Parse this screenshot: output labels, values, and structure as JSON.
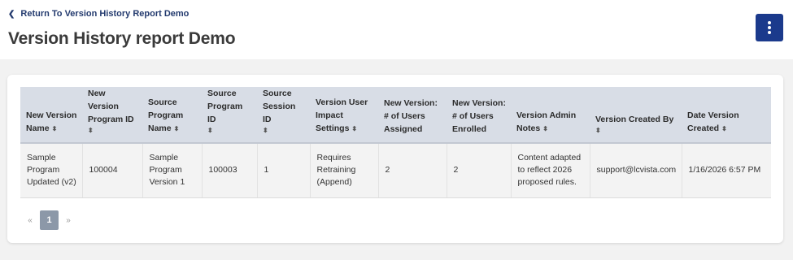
{
  "header": {
    "back_link": "Return To Version History Report Demo",
    "title": "Version History report Demo"
  },
  "table": {
    "columns": [
      {
        "label": "New Version Name",
        "sort": "⬍"
      },
      {
        "label": "New Version Program ID",
        "sort": "⬍"
      },
      {
        "label": "Source Program Name",
        "sort": "⬍"
      },
      {
        "label": "Source Program ID",
        "sort": "⬍"
      },
      {
        "label": "Source Session ID",
        "sort": "⬍"
      },
      {
        "label": "Version User Impact Settings",
        "sort": "⬍"
      },
      {
        "label": "New Version: # of Users Assigned",
        "sort": ""
      },
      {
        "label": "New Version: # of Users Enrolled",
        "sort": ""
      },
      {
        "label": "Version Admin Notes",
        "sort": "⬍"
      },
      {
        "label": "Version Created By",
        "sort": "⬍"
      },
      {
        "label": "Date Version Created",
        "sort": "⬍"
      }
    ],
    "rows": [
      [
        "Sample Program Updated (v2)",
        "100004",
        "Sample Program Version 1",
        "100003",
        "1",
        "Requires Retraining (Append)",
        "2",
        "2",
        "Content adapted to reflect 2026 proposed rules.",
        "support@lcvista.com",
        "1/16/2026 6:57 PM"
      ]
    ]
  },
  "pagination": {
    "prev": "«",
    "current": "1",
    "next": "»"
  },
  "colors": {
    "accent": "#1b3a8c",
    "link": "#233a6e",
    "header_bg": "#d8dde6"
  }
}
